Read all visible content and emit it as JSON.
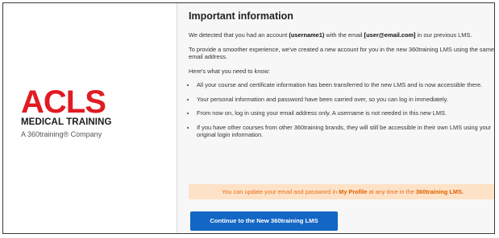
{
  "brand": {
    "logo_text": "ACLS",
    "logo_subtitle": "MEDICAL TRAINING",
    "company_line": "A 360training® Company",
    "accent_red": "#e11b22"
  },
  "main": {
    "title": "Important information",
    "p1": {
      "a": "We detected that you had an account ",
      "username": "(username1)",
      "b": " with the email ",
      "email": "[user@email.com]",
      "c": " in our previous LMS."
    },
    "p2": "To provide a smoother experience, we've created a new account for you in the new 360training LMS using the same email address.",
    "p3": "Here's what you need to know:",
    "bullets": [
      "All your course and certificate information has been transferred to the new LMS and is now accessible there.",
      "Your personal information and password have been carried over, so you can log in immediately.",
      "From now on, log in using your email address only. A username is not needed in this new LMS.",
      "If you have other courses from other 360training brands, they will still be accessible in their own LMS using your original login information."
    ],
    "notice": {
      "a": "You can update your email and password in ",
      "link1": "My Profile",
      "b": " at any time in the ",
      "link2": "360training LMS.",
      "bg": "#fde2c7",
      "text_color": "#e8701a"
    },
    "cta_label": "Continue to the New 360training LMS",
    "cta_color": "#1366c4"
  }
}
